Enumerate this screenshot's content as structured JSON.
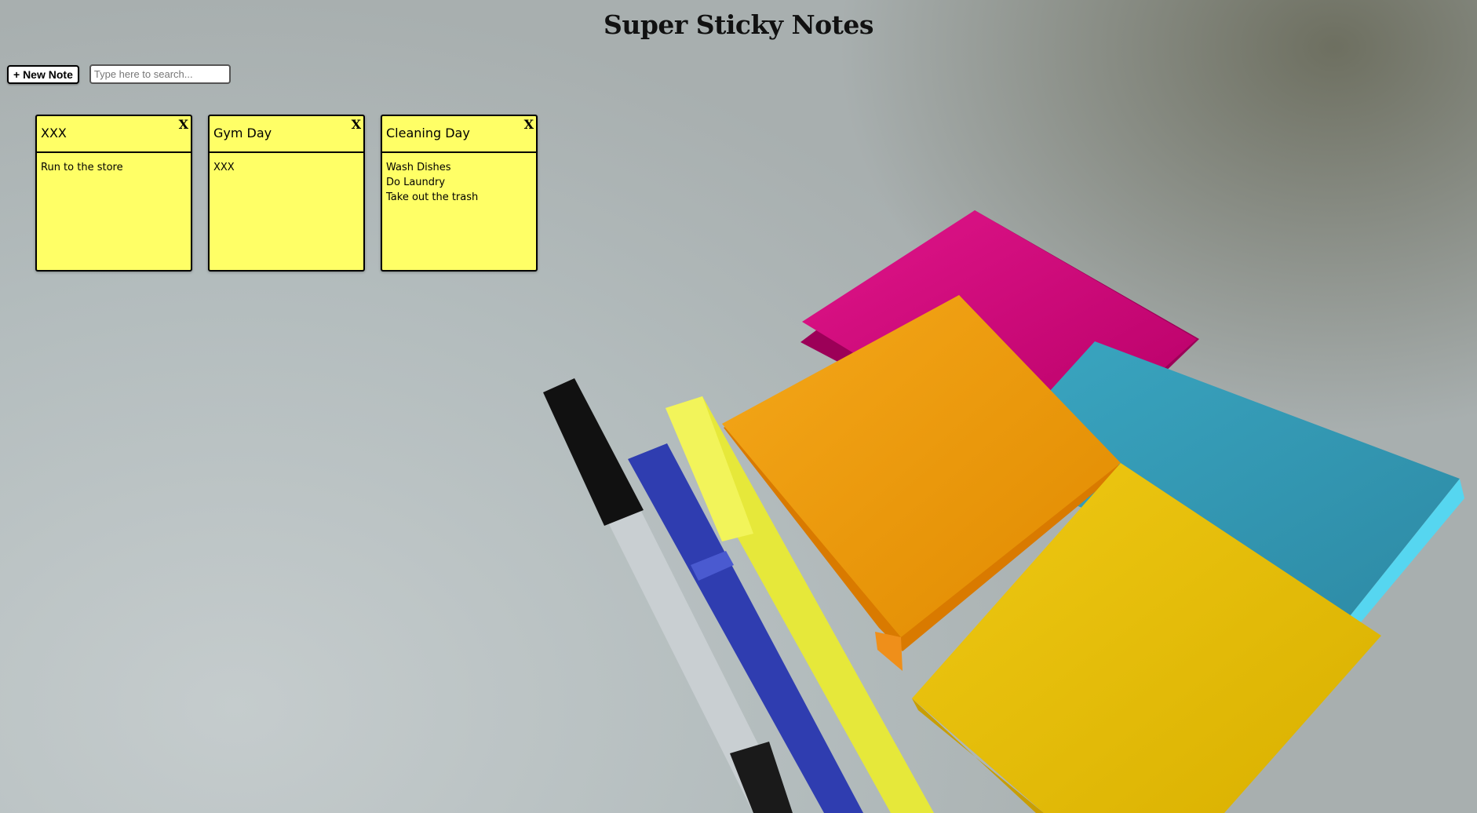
{
  "app": {
    "title": "Super Sticky Notes"
  },
  "toolbar": {
    "new_note_label": "+ New Note",
    "search_placeholder": "Type here to search...",
    "search_value": ""
  },
  "notes": [
    {
      "title": "XXX",
      "close_label": "X",
      "lines": [
        "Run to the store"
      ]
    },
    {
      "title": "Gym Day",
      "close_label": "X",
      "lines": [
        "XXX"
      ]
    },
    {
      "title": "Cleaning Day",
      "close_label": "X",
      "lines": [
        "Wash Dishes",
        "Do Laundry",
        "Take out the trash"
      ]
    }
  ],
  "colors": {
    "note_background": "#ffff66",
    "note_border": "#000000",
    "background_photo_pads": [
      "#d4007a",
      "#f0a000",
      "#39a7c2",
      "#e8c400"
    ]
  }
}
